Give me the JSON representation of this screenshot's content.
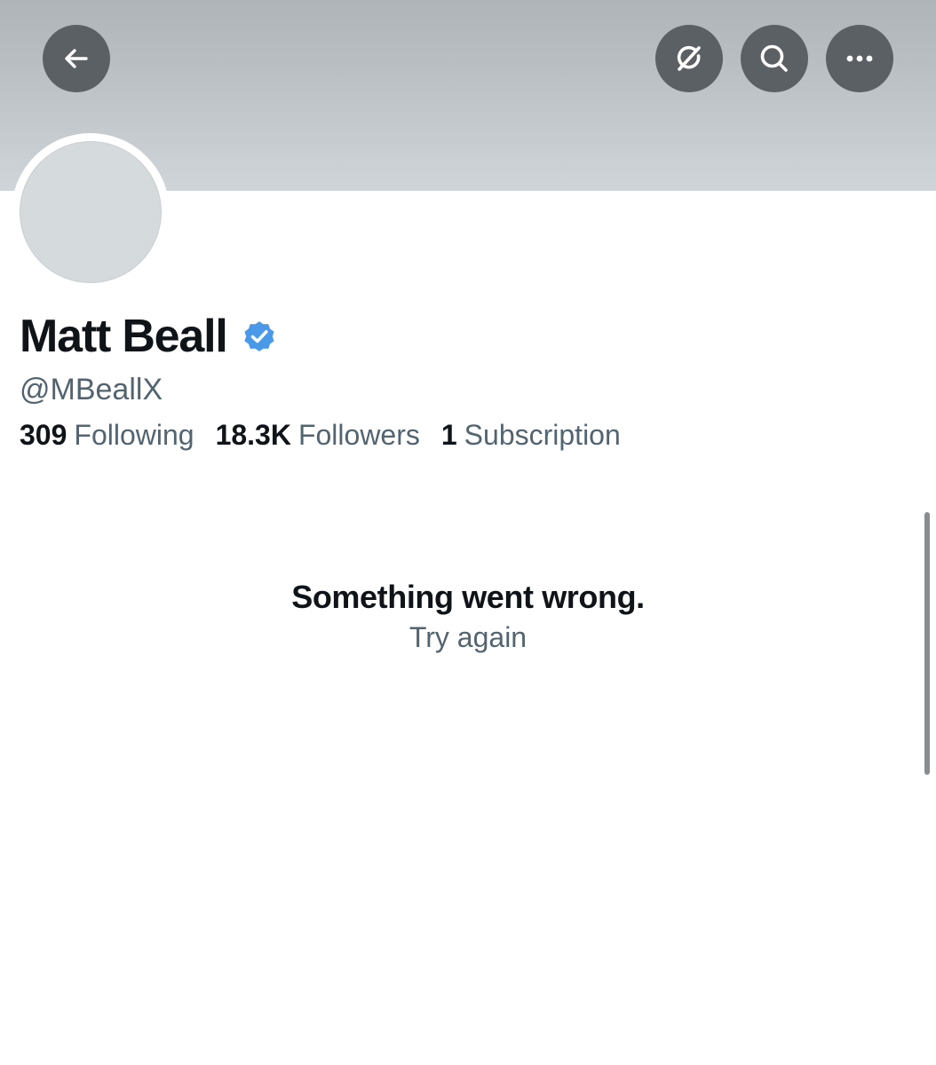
{
  "header": {
    "back_icon": "arrow-left-icon",
    "grok_icon": "grok-icon",
    "search_icon": "search-icon",
    "more_icon": "more-horizontal-icon",
    "button_color": "#5b6064"
  },
  "profile": {
    "display_name": "Matt Beall",
    "verified_icon": "verified-badge-icon",
    "verified_color": "#4a99e9",
    "handle": "@MBeallX",
    "stats": [
      {
        "value": "309",
        "label": "Following"
      },
      {
        "value": "18.3K",
        "label": "Followers"
      },
      {
        "value": "1",
        "label": "Subscription"
      }
    ]
  },
  "error": {
    "title": "Something went wrong.",
    "retry_label": "Try again"
  }
}
